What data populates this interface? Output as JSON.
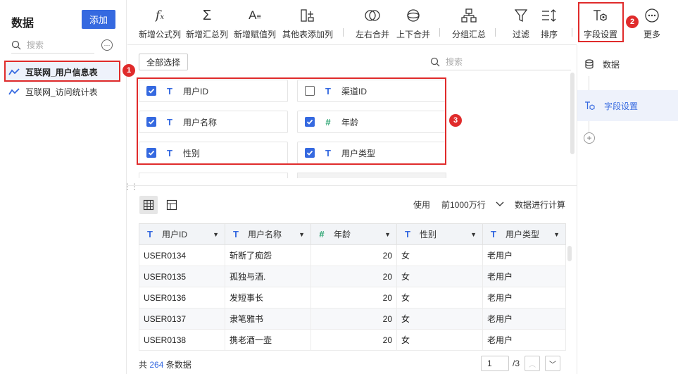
{
  "left_panel": {
    "title": "数据",
    "add_button": "添加",
    "search_placeholder": "搜索",
    "datasets": [
      {
        "label": "互联网_用户信息表",
        "active": true
      },
      {
        "label": "互联网_访问统计表",
        "active": false
      }
    ]
  },
  "toolbar": {
    "items": [
      {
        "label": "新增公式列",
        "icon": "formula-icon"
      },
      {
        "label": "新增汇总列",
        "icon": "sigma-icon"
      },
      {
        "label": "新增赋值列",
        "icon": "assign-icon"
      },
      {
        "label": "其他表添加列",
        "icon": "add-column-icon"
      },
      {
        "label": "左右合并",
        "icon": "merge-horizontal-icon"
      },
      {
        "label": "上下合并",
        "icon": "merge-vertical-icon"
      },
      {
        "label": "分组汇总",
        "icon": "group-summary-icon"
      },
      {
        "label": "过滤",
        "icon": "filter-icon"
      },
      {
        "label": "排序",
        "icon": "sort-icon"
      },
      {
        "label": "字段设置",
        "icon": "field-settings-icon"
      },
      {
        "label": "更多",
        "icon": "more-icon"
      }
    ]
  },
  "annotations": {
    "badge1": "1",
    "badge2": "2",
    "badge3": "3",
    "accent": "#e02b2b"
  },
  "field_panel": {
    "select_all": "全部选择",
    "search_placeholder": "搜索",
    "fields": [
      {
        "name": "用户ID",
        "type": "text",
        "checked": true
      },
      {
        "name": "渠道ID",
        "type": "text",
        "checked": false
      },
      {
        "name": "用户名称",
        "type": "text",
        "checked": true
      },
      {
        "name": "年龄",
        "type": "number",
        "checked": true
      },
      {
        "name": "性别",
        "type": "text",
        "checked": true
      },
      {
        "name": "用户类型",
        "type": "text",
        "checked": true
      }
    ]
  },
  "preview": {
    "use_label": "使用",
    "row_limit": "前1000万行",
    "calc_label": "数据进行计算",
    "columns": [
      {
        "name": "用户ID",
        "type": "text"
      },
      {
        "name": "用户名称",
        "type": "text"
      },
      {
        "name": "年龄",
        "type": "number"
      },
      {
        "name": "性别",
        "type": "text"
      },
      {
        "name": "用户类型",
        "type": "text"
      }
    ],
    "rows": [
      [
        "USER0134",
        "斩断了痴怨",
        "20",
        "女",
        "老用户"
      ],
      [
        "USER0135",
        "孤独与酒.",
        "20",
        "女",
        "老用户"
      ],
      [
        "USER0136",
        "发短事长",
        "20",
        "女",
        "老用户"
      ],
      [
        "USER0137",
        "隶笔雅书",
        "20",
        "女",
        "老用户"
      ],
      [
        "USER0138",
        "携老酒一壶",
        "20",
        "女",
        "老用户"
      ]
    ],
    "total_prefix": "共",
    "total_count": "264",
    "total_suffix": "条数据",
    "page_current": "1",
    "page_total": "/3"
  },
  "right_panel": {
    "items": [
      {
        "label": "数据",
        "icon": "database-icon"
      },
      {
        "label": "字段设置",
        "icon": "field-settings-icon"
      }
    ]
  },
  "colors": {
    "primary": "#3569e0",
    "number_type": "#2ba471"
  }
}
